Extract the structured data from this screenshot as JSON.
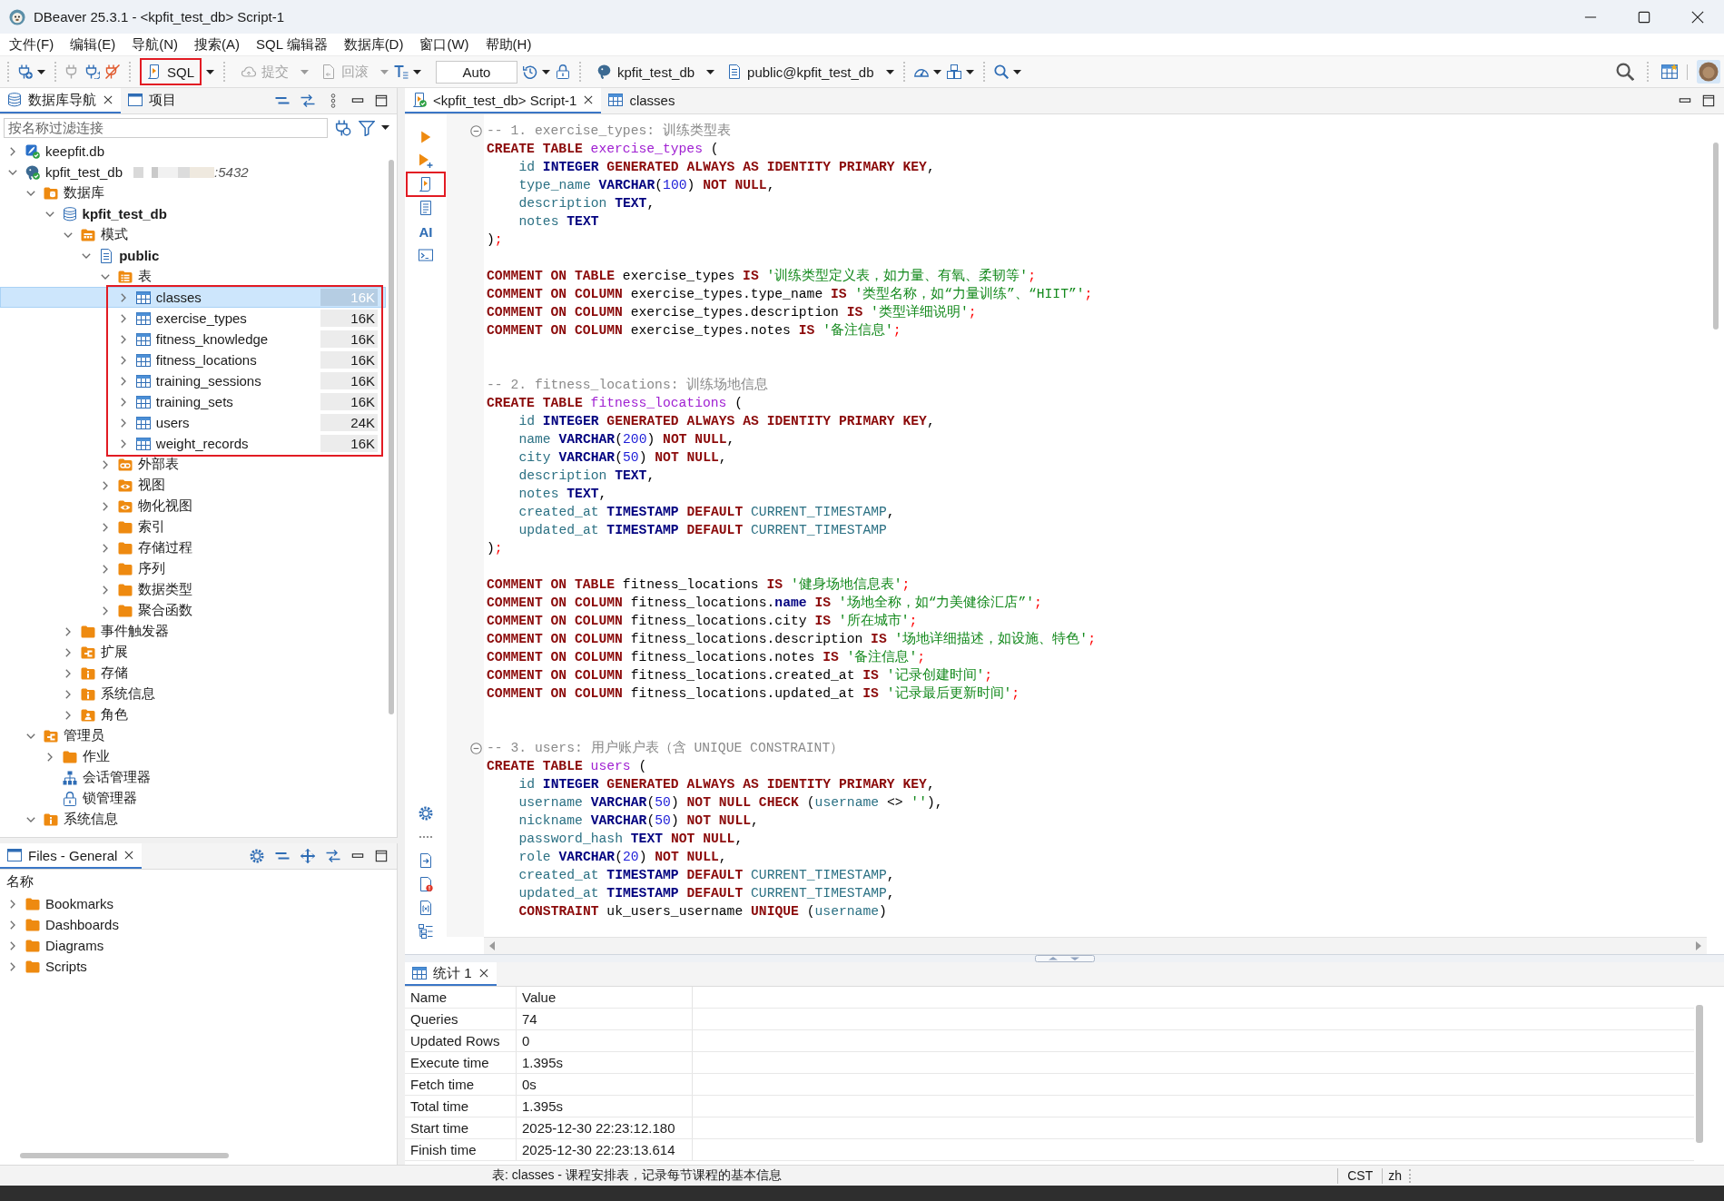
{
  "window": {
    "title": "DBeaver 25.3.1 - <kpfit_test_db> Script-1"
  },
  "menu": [
    "文件(F)",
    "编辑(E)",
    "导航(N)",
    "搜索(A)",
    "SQL 编辑器",
    "数据库(D)",
    "窗口(W)",
    "帮助(H)"
  ],
  "toolbar": {
    "sql_button": {
      "label": "SQL",
      "highlighted": true
    },
    "commit_button": {
      "label": "提交",
      "disabled": true
    },
    "rollback_button": {
      "label": "回滚",
      "disabled": true
    },
    "transaction_mode": {
      "value": "Auto"
    },
    "connection_selector": {
      "label": "kpfit_test_db"
    },
    "schema_selector": {
      "label": "public@kpfit_test_db"
    }
  },
  "navigator": {
    "tabs": [
      {
        "label": "数据库导航",
        "kind": "database",
        "selected": true
      },
      {
        "label": "项目",
        "kind": "project",
        "selected": false
      }
    ],
    "filter": {
      "placeholder": "按名称过滤连接"
    },
    "tree": [
      {
        "label": "keepfit.db",
        "kind": "sqlite",
        "expanded": false,
        "selected": false
      },
      {
        "label": "kpfit_test_db",
        "kind": "connection",
        "expanded": true,
        "selected": false,
        "host": ":5432",
        "children": [
          {
            "label": "数据库",
            "kind": "databases",
            "expanded": true,
            "selected": false,
            "children": [
              {
                "label": "kpfit_test_db",
                "kind": "database",
                "expanded": true,
                "selected": false,
                "children": [
                  {
                    "label": "模式",
                    "kind": "schemas",
                    "expanded": true,
                    "selected": false,
                    "children": [
                      {
                        "label": "public",
                        "kind": "schema",
                        "expanded": true,
                        "selected": false,
                        "children": [
                          {
                            "label": "表",
                            "kind": "tables",
                            "expanded": true,
                            "selected": false,
                            "children": [
                              {
                                "label": "classes",
                                "kind": "table",
                                "expanded": false,
                                "selected": true,
                                "size": "16K"
                              },
                              {
                                "label": "exercise_types",
                                "kind": "table",
                                "expanded": false,
                                "selected": false,
                                "size": "16K"
                              },
                              {
                                "label": "fitness_knowledge",
                                "kind": "table",
                                "expanded": false,
                                "selected": false,
                                "size": "16K"
                              },
                              {
                                "label": "fitness_locations",
                                "kind": "table",
                                "expanded": false,
                                "selected": false,
                                "size": "16K"
                              },
                              {
                                "label": "training_sessions",
                                "kind": "table",
                                "expanded": false,
                                "selected": false,
                                "size": "16K"
                              },
                              {
                                "label": "training_sets",
                                "kind": "table",
                                "expanded": false,
                                "selected": false,
                                "size": "16K"
                              },
                              {
                                "label": "users",
                                "kind": "table",
                                "expanded": false,
                                "selected": false,
                                "size": "24K"
                              },
                              {
                                "label": "weight_records",
                                "kind": "table",
                                "expanded": false,
                                "selected": false,
                                "size": "16K"
                              }
                            ]
                          },
                          {
                            "label": "外部表",
                            "kind": "foreign_tables",
                            "expanded": false,
                            "selected": false
                          },
                          {
                            "label": "视图",
                            "kind": "views",
                            "expanded": false,
                            "selected": false
                          },
                          {
                            "label": "物化视图",
                            "kind": "views",
                            "expanded": false,
                            "selected": false
                          },
                          {
                            "label": "索引",
                            "kind": "folder",
                            "expanded": false,
                            "selected": false
                          },
                          {
                            "label": "存储过程",
                            "kind": "folder",
                            "expanded": false,
                            "selected": false
                          },
                          {
                            "label": "序列",
                            "kind": "folder",
                            "expanded": false,
                            "selected": false
                          },
                          {
                            "label": "数据类型",
                            "kind": "folder",
                            "expanded": false,
                            "selected": false
                          },
                          {
                            "label": "聚合函数",
                            "kind": "folder",
                            "expanded": false,
                            "selected": false
                          }
                        ]
                      }
                    ]
                  },
                  {
                    "label": "事件触发器",
                    "kind": "folder",
                    "expanded": false,
                    "selected": false
                  },
                  {
                    "label": "扩展",
                    "kind": "extensions",
                    "expanded": false,
                    "selected": false
                  },
                  {
                    "label": "存储",
                    "kind": "info",
                    "expanded": false,
                    "selected": false
                  },
                  {
                    "label": "系统信息",
                    "kind": "info",
                    "expanded": false,
                    "selected": false
                  },
                  {
                    "label": "角色",
                    "kind": "roles",
                    "expanded": false,
                    "selected": false
                  }
                ]
              }
            ]
          },
          {
            "label": "管理员",
            "kind": "admin",
            "expanded": true,
            "selected": false,
            "children": [
              {
                "label": "作业",
                "kind": "folder",
                "expanded": false,
                "selected": false
              },
              {
                "label": "会话管理器",
                "kind": "sessions",
                "selected": false
              },
              {
                "label": "锁管理器",
                "kind": "locks",
                "selected": false
              }
            ]
          },
          {
            "label": "系统信息",
            "kind": "info",
            "expanded": true,
            "selected": false
          }
        ]
      }
    ]
  },
  "files": {
    "tabs": [
      {
        "label": "Files - General",
        "selected": true
      }
    ],
    "column_header": "名称",
    "items": [
      {
        "label": "Bookmarks",
        "expanded": false,
        "selected": false
      },
      {
        "label": "Dashboards",
        "expanded": false,
        "selected": false
      },
      {
        "label": "Diagrams",
        "expanded": false,
        "selected": false
      },
      {
        "label": "Scripts",
        "expanded": false,
        "selected": false
      }
    ]
  },
  "editor": {
    "tabs": [
      {
        "label": "<kpfit_test_db> Script-1",
        "kind": "script",
        "selected": true
      },
      {
        "label": "classes",
        "kind": "table",
        "selected": false
      }
    ],
    "side_toolbar": {
      "script_button": {
        "highlighted": true
      },
      "ai_button": {
        "label": "AI"
      }
    },
    "sections": [
      {
        "foldable": true,
        "blocks": [
          {
            "lines": [
              {
                "indented": false,
                "tokens": [
                  {
                    "kind": "comment",
                    "text": "-- 1. exercise_types: 训练类型表"
                  }
                ]
              },
              {
                "indented": false,
                "tokens": [
                  {
                    "kind": "keyword",
                    "text": "CREATE TABLE "
                  },
                  {
                    "kind": "table",
                    "text": "exercise_types"
                  },
                  {
                    "kind": "text",
                    "text": " ("
                  }
                ]
              },
              {
                "indented": true,
                "tokens": [
                  {
                    "kind": "identifier",
                    "text": "id "
                  },
                  {
                    "kind": "datatype",
                    "text": "INTEGER "
                  },
                  {
                    "kind": "keyword",
                    "text": "GENERATED ALWAYS AS IDENTITY PRIMARY KEY"
                  },
                  {
                    "kind": "text",
                    "text": ","
                  }
                ]
              },
              {
                "indented": true,
                "tokens": [
                  {
                    "kind": "identifier",
                    "text": "type_name "
                  },
                  {
                    "kind": "datatype",
                    "text": "VARCHAR"
                  },
                  {
                    "kind": "text",
                    "text": "("
                  },
                  {
                    "kind": "number",
                    "text": "100"
                  },
                  {
                    "kind": "text",
                    "text": ") "
                  },
                  {
                    "kind": "keyword",
                    "text": "NOT NULL"
                  },
                  {
                    "kind": "text",
                    "text": ","
                  }
                ]
              },
              {
                "indented": true,
                "tokens": [
                  {
                    "kind": "identifier",
                    "text": "description "
                  },
                  {
                    "kind": "datatype",
                    "text": "TEXT"
                  },
                  {
                    "kind": "text",
                    "text": ","
                  }
                ]
              },
              {
                "indented": true,
                "tokens": [
                  {
                    "kind": "identifier",
                    "text": "notes "
                  },
                  {
                    "kind": "datatype",
                    "text": "TEXT"
                  }
                ]
              },
              {
                "indented": false,
                "tokens": [
                  {
                    "kind": "text",
                    "text": ")"
                  },
                  {
                    "kind": "delimiter",
                    "text": ";"
                  }
                ]
              }
            ]
          },
          {
            "lines": [
              {
                "indented": false,
                "tokens": [
                  {
                    "kind": "keyword",
                    "text": "COMMENT ON TABLE "
                  },
                  {
                    "kind": "text",
                    "text": "exercise_types "
                  },
                  {
                    "kind": "keyword",
                    "text": "IS "
                  },
                  {
                    "kind": "string",
                    "text": "'训练类型定义表，如力量、有氧、柔韧等'"
                  },
                  {
                    "kind": "delimiter",
                    "text": ";"
                  }
                ]
              },
              {
                "indented": false,
                "tokens": [
                  {
                    "kind": "keyword",
                    "text": "COMMENT ON COLUMN "
                  },
                  {
                    "kind": "text",
                    "text": "exercise_types.type_name "
                  },
                  {
                    "kind": "keyword",
                    "text": "IS "
                  },
                  {
                    "kind": "string",
                    "text": "'类型名称，如“力量训练”、“HIIT”'"
                  },
                  {
                    "kind": "delimiter",
                    "text": ";"
                  }
                ]
              },
              {
                "indented": false,
                "tokens": [
                  {
                    "kind": "keyword",
                    "text": "COMMENT ON COLUMN "
                  },
                  {
                    "kind": "text",
                    "text": "exercise_types.description "
                  },
                  {
                    "kind": "keyword",
                    "text": "IS "
                  },
                  {
                    "kind": "string",
                    "text": "'类型详细说明'"
                  },
                  {
                    "kind": "delimiter",
                    "text": ";"
                  }
                ]
              },
              {
                "indented": false,
                "tokens": [
                  {
                    "kind": "keyword",
                    "text": "COMMENT ON COLUMN "
                  },
                  {
                    "kind": "text",
                    "text": "exercise_types.notes "
                  },
                  {
                    "kind": "keyword",
                    "text": "IS "
                  },
                  {
                    "kind": "string",
                    "text": "'备注信息'"
                  },
                  {
                    "kind": "delimiter",
                    "text": ";"
                  }
                ]
              }
            ]
          }
        ]
      },
      {
        "foldable": false,
        "blocks": [
          {
            "lines": [
              {
                "indented": false,
                "tokens": [
                  {
                    "kind": "comment",
                    "text": "-- 2. fitness_locations: 训练场地信息"
                  }
                ]
              },
              {
                "indented": false,
                "tokens": [
                  {
                    "kind": "keyword",
                    "text": "CREATE TABLE "
                  },
                  {
                    "kind": "table",
                    "text": "fitness_locations"
                  },
                  {
                    "kind": "text",
                    "text": " ("
                  }
                ]
              },
              {
                "indented": true,
                "tokens": [
                  {
                    "kind": "identifier",
                    "text": "id "
                  },
                  {
                    "kind": "datatype",
                    "text": "INTEGER "
                  },
                  {
                    "kind": "keyword",
                    "text": "GENERATED ALWAYS AS IDENTITY PRIMARY KEY"
                  },
                  {
                    "kind": "text",
                    "text": ","
                  }
                ]
              },
              {
                "indented": true,
                "tokens": [
                  {
                    "kind": "identifier",
                    "text": "name "
                  },
                  {
                    "kind": "datatype",
                    "text": "VARCHAR"
                  },
                  {
                    "kind": "text",
                    "text": "("
                  },
                  {
                    "kind": "number",
                    "text": "200"
                  },
                  {
                    "kind": "text",
                    "text": ") "
                  },
                  {
                    "kind": "keyword",
                    "text": "NOT NULL"
                  },
                  {
                    "kind": "text",
                    "text": ","
                  }
                ]
              },
              {
                "indented": true,
                "tokens": [
                  {
                    "kind": "identifier",
                    "text": "city "
                  },
                  {
                    "kind": "datatype",
                    "text": "VARCHAR"
                  },
                  {
                    "kind": "text",
                    "text": "("
                  },
                  {
                    "kind": "number",
                    "text": "50"
                  },
                  {
                    "kind": "text",
                    "text": ") "
                  },
                  {
                    "kind": "keyword",
                    "text": "NOT NULL"
                  },
                  {
                    "kind": "text",
                    "text": ","
                  }
                ]
              },
              {
                "indented": true,
                "tokens": [
                  {
                    "kind": "identifier",
                    "text": "description "
                  },
                  {
                    "kind": "datatype",
                    "text": "TEXT"
                  },
                  {
                    "kind": "text",
                    "text": ","
                  }
                ]
              },
              {
                "indented": true,
                "tokens": [
                  {
                    "kind": "identifier",
                    "text": "notes "
                  },
                  {
                    "kind": "datatype",
                    "text": "TEXT"
                  },
                  {
                    "kind": "text",
                    "text": ","
                  }
                ]
              },
              {
                "indented": true,
                "tokens": [
                  {
                    "kind": "identifier",
                    "text": "created_at "
                  },
                  {
                    "kind": "datatype",
                    "text": "TIMESTAMP "
                  },
                  {
                    "kind": "keyword",
                    "text": "DEFAULT "
                  },
                  {
                    "kind": "identifier",
                    "text": "CURRENT_TIMESTAMP"
                  },
                  {
                    "kind": "text",
                    "text": ","
                  }
                ]
              },
              {
                "indented": true,
                "tokens": [
                  {
                    "kind": "identifier",
                    "text": "updated_at "
                  },
                  {
                    "kind": "datatype",
                    "text": "TIMESTAMP "
                  },
                  {
                    "kind": "keyword",
                    "text": "DEFAULT "
                  },
                  {
                    "kind": "identifier",
                    "text": "CURRENT_TIMESTAMP"
                  }
                ]
              },
              {
                "indented": false,
                "tokens": [
                  {
                    "kind": "text",
                    "text": ")"
                  },
                  {
                    "kind": "delimiter",
                    "text": ";"
                  }
                ]
              }
            ]
          },
          {
            "lines": [
              {
                "indented": false,
                "tokens": [
                  {
                    "kind": "keyword",
                    "text": "COMMENT ON TABLE "
                  },
                  {
                    "kind": "text",
                    "text": "fitness_locations "
                  },
                  {
                    "kind": "keyword",
                    "text": "IS "
                  },
                  {
                    "kind": "string",
                    "text": "'健身场地信息表'"
                  },
                  {
                    "kind": "delimiter",
                    "text": ";"
                  }
                ]
              },
              {
                "indented": false,
                "tokens": [
                  {
                    "kind": "keyword",
                    "text": "COMMENT ON COLUMN "
                  },
                  {
                    "kind": "text",
                    "text": "fitness_locations."
                  },
                  {
                    "kind": "reserved",
                    "text": "name "
                  },
                  {
                    "kind": "keyword",
                    "text": "IS "
                  },
                  {
                    "kind": "string",
                    "text": "'场地全称，如“力美健徐汇店”'"
                  },
                  {
                    "kind": "delimiter",
                    "text": ";"
                  }
                ]
              },
              {
                "indented": false,
                "tokens": [
                  {
                    "kind": "keyword",
                    "text": "COMMENT ON COLUMN "
                  },
                  {
                    "kind": "text",
                    "text": "fitness_locations.city "
                  },
                  {
                    "kind": "keyword",
                    "text": "IS "
                  },
                  {
                    "kind": "string",
                    "text": "'所在城市'"
                  },
                  {
                    "kind": "delimiter",
                    "text": ";"
                  }
                ]
              },
              {
                "indented": false,
                "tokens": [
                  {
                    "kind": "keyword",
                    "text": "COMMENT ON COLUMN "
                  },
                  {
                    "kind": "text",
                    "text": "fitness_locations.description "
                  },
                  {
                    "kind": "keyword",
                    "text": "IS "
                  },
                  {
                    "kind": "string",
                    "text": "'场地详细描述，如设施、特色'"
                  },
                  {
                    "kind": "delimiter",
                    "text": ";"
                  }
                ]
              },
              {
                "indented": false,
                "tokens": [
                  {
                    "kind": "keyword",
                    "text": "COMMENT ON COLUMN "
                  },
                  {
                    "kind": "text",
                    "text": "fitness_locations.notes "
                  },
                  {
                    "kind": "keyword",
                    "text": "IS "
                  },
                  {
                    "kind": "string",
                    "text": "'备注信息'"
                  },
                  {
                    "kind": "delimiter",
                    "text": ";"
                  }
                ]
              },
              {
                "indented": false,
                "tokens": [
                  {
                    "kind": "keyword",
                    "text": "COMMENT ON COLUMN "
                  },
                  {
                    "kind": "text",
                    "text": "fitness_locations.created_at "
                  },
                  {
                    "kind": "keyword",
                    "text": "IS "
                  },
                  {
                    "kind": "string",
                    "text": "'记录创建时间'"
                  },
                  {
                    "kind": "delimiter",
                    "text": ";"
                  }
                ]
              },
              {
                "indented": false,
                "tokens": [
                  {
                    "kind": "keyword",
                    "text": "COMMENT ON COLUMN "
                  },
                  {
                    "kind": "text",
                    "text": "fitness_locations.updated_at "
                  },
                  {
                    "kind": "keyword",
                    "text": "IS "
                  },
                  {
                    "kind": "string",
                    "text": "'记录最后更新时间'"
                  },
                  {
                    "kind": "delimiter",
                    "text": ";"
                  }
                ]
              }
            ]
          }
        ]
      },
      {
        "foldable": true,
        "blocks": [
          {
            "lines": [
              {
                "indented": false,
                "tokens": [
                  {
                    "kind": "comment",
                    "text": "-- 3. users: 用户账户表（含 UNIQUE CONSTRAINT）"
                  }
                ]
              },
              {
                "indented": false,
                "tokens": [
                  {
                    "kind": "keyword",
                    "text": "CREATE TABLE "
                  },
                  {
                    "kind": "table",
                    "text": "users"
                  },
                  {
                    "kind": "text",
                    "text": " ("
                  }
                ]
              },
              {
                "indented": true,
                "tokens": [
                  {
                    "kind": "identifier",
                    "text": "id "
                  },
                  {
                    "kind": "datatype",
                    "text": "INTEGER "
                  },
                  {
                    "kind": "keyword",
                    "text": "GENERATED ALWAYS AS IDENTITY PRIMARY KEY"
                  },
                  {
                    "kind": "text",
                    "text": ","
                  }
                ]
              },
              {
                "indented": true,
                "tokens": [
                  {
                    "kind": "identifier",
                    "text": "username "
                  },
                  {
                    "kind": "datatype",
                    "text": "VARCHAR"
                  },
                  {
                    "kind": "text",
                    "text": "("
                  },
                  {
                    "kind": "number",
                    "text": "50"
                  },
                  {
                    "kind": "text",
                    "text": ") "
                  },
                  {
                    "kind": "keyword",
                    "text": "NOT NULL CHECK "
                  },
                  {
                    "kind": "text",
                    "text": "("
                  },
                  {
                    "kind": "identifier",
                    "text": "username"
                  },
                  {
                    "kind": "text",
                    "text": " <> "
                  },
                  {
                    "kind": "string",
                    "text": "''"
                  },
                  {
                    "kind": "text",
                    "text": "),"
                  }
                ]
              },
              {
                "indented": true,
                "tokens": [
                  {
                    "kind": "identifier",
                    "text": "nickname "
                  },
                  {
                    "kind": "datatype",
                    "text": "VARCHAR"
                  },
                  {
                    "kind": "text",
                    "text": "("
                  },
                  {
                    "kind": "number",
                    "text": "50"
                  },
                  {
                    "kind": "text",
                    "text": ") "
                  },
                  {
                    "kind": "keyword",
                    "text": "NOT NULL"
                  },
                  {
                    "kind": "text",
                    "text": ","
                  }
                ]
              },
              {
                "indented": true,
                "tokens": [
                  {
                    "kind": "identifier",
                    "text": "password_hash "
                  },
                  {
                    "kind": "datatype",
                    "text": "TEXT "
                  },
                  {
                    "kind": "keyword",
                    "text": "NOT NULL"
                  },
                  {
                    "kind": "text",
                    "text": ","
                  }
                ]
              },
              {
                "indented": true,
                "tokens": [
                  {
                    "kind": "identifier",
                    "text": "role "
                  },
                  {
                    "kind": "datatype",
                    "text": "VARCHAR"
                  },
                  {
                    "kind": "text",
                    "text": "("
                  },
                  {
                    "kind": "number",
                    "text": "20"
                  },
                  {
                    "kind": "text",
                    "text": ") "
                  },
                  {
                    "kind": "keyword",
                    "text": "NOT NULL"
                  },
                  {
                    "kind": "text",
                    "text": ","
                  }
                ]
              },
              {
                "indented": true,
                "tokens": [
                  {
                    "kind": "identifier",
                    "text": "created_at "
                  },
                  {
                    "kind": "datatype",
                    "text": "TIMESTAMP "
                  },
                  {
                    "kind": "keyword",
                    "text": "DEFAULT "
                  },
                  {
                    "kind": "identifier",
                    "text": "CURRENT_TIMESTAMP"
                  },
                  {
                    "kind": "text",
                    "text": ","
                  }
                ]
              },
              {
                "indented": true,
                "tokens": [
                  {
                    "kind": "identifier",
                    "text": "updated_at "
                  },
                  {
                    "kind": "datatype",
                    "text": "TIMESTAMP "
                  },
                  {
                    "kind": "keyword",
                    "text": "DEFAULT "
                  },
                  {
                    "kind": "identifier",
                    "text": "CURRENT_TIMESTAMP"
                  },
                  {
                    "kind": "text",
                    "text": ","
                  }
                ]
              },
              {
                "indented": true,
                "tokens": [
                  {
                    "kind": "keyword",
                    "text": "CONSTRAINT "
                  },
                  {
                    "kind": "text",
                    "text": "uk_users_username "
                  },
                  {
                    "kind": "keyword",
                    "text": "UNIQUE "
                  },
                  {
                    "kind": "text",
                    "text": "("
                  },
                  {
                    "kind": "identifier",
                    "text": "username"
                  },
                  {
                    "kind": "text",
                    "text": ")"
                  }
                ]
              }
            ]
          }
        ]
      }
    ]
  },
  "results": {
    "tabs": [
      {
        "label": "统计 1",
        "selected": true
      }
    ],
    "columns": [
      "Name",
      "Value"
    ],
    "rows": [
      [
        "Queries",
        "74"
      ],
      [
        "Updated Rows",
        "0"
      ],
      [
        "Execute time",
        "1.395s"
      ],
      [
        "Fetch time",
        "0s"
      ],
      [
        "Total time",
        "1.395s"
      ],
      [
        "Start time",
        "2025-12-30 22:23:12.180"
      ],
      [
        "Finish time",
        "2025-12-30 22:23:13.614"
      ]
    ]
  },
  "status_bar": {
    "message": "表: classes - 课程安排表，记录每节课程的基本信息",
    "timezone": "CST",
    "locale": "zh"
  }
}
